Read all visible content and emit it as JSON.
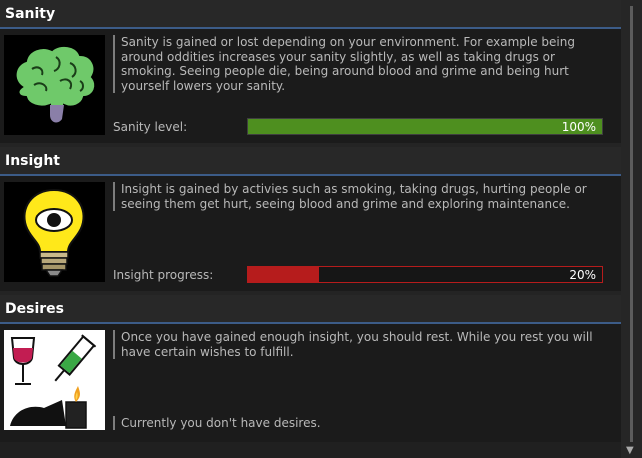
{
  "sections": [
    {
      "title": "Sanity",
      "icon": "brain-icon",
      "description": "Sanity is gained or lost depending on your environment. For example being around oddities increases your sanity slightly, as well as taking drugs or smoking. Seeing people die, being around blood and grime and being hurt yourself lowers your sanity.",
      "meter_label": "Sanity level:",
      "meter_value": "100%",
      "meter_fraction": 1.0,
      "meter_color": "#4e8f1f"
    },
    {
      "title": "Insight",
      "icon": "lightbulb-eye-icon",
      "description": "Insight is gained by activies such as smoking, taking drugs, hurting people or seeing them get hurt, seeing blood and grime and exploring maintenance.",
      "meter_label": "Insight progress:",
      "meter_value": "20%",
      "meter_fraction": 0.2,
      "meter_color": "#b61c1c"
    },
    {
      "title": "Desires",
      "icon": "vices-icon",
      "description": "Once you have gained enough insight, you should rest. While you rest you will have certain wishes to fulfill.",
      "status": "Currently you don't have desires."
    }
  ],
  "colors": {
    "header_border": "#3c5c88",
    "sanity_bar": "#4e8f1f",
    "insight_bar": "#b61c1c"
  }
}
